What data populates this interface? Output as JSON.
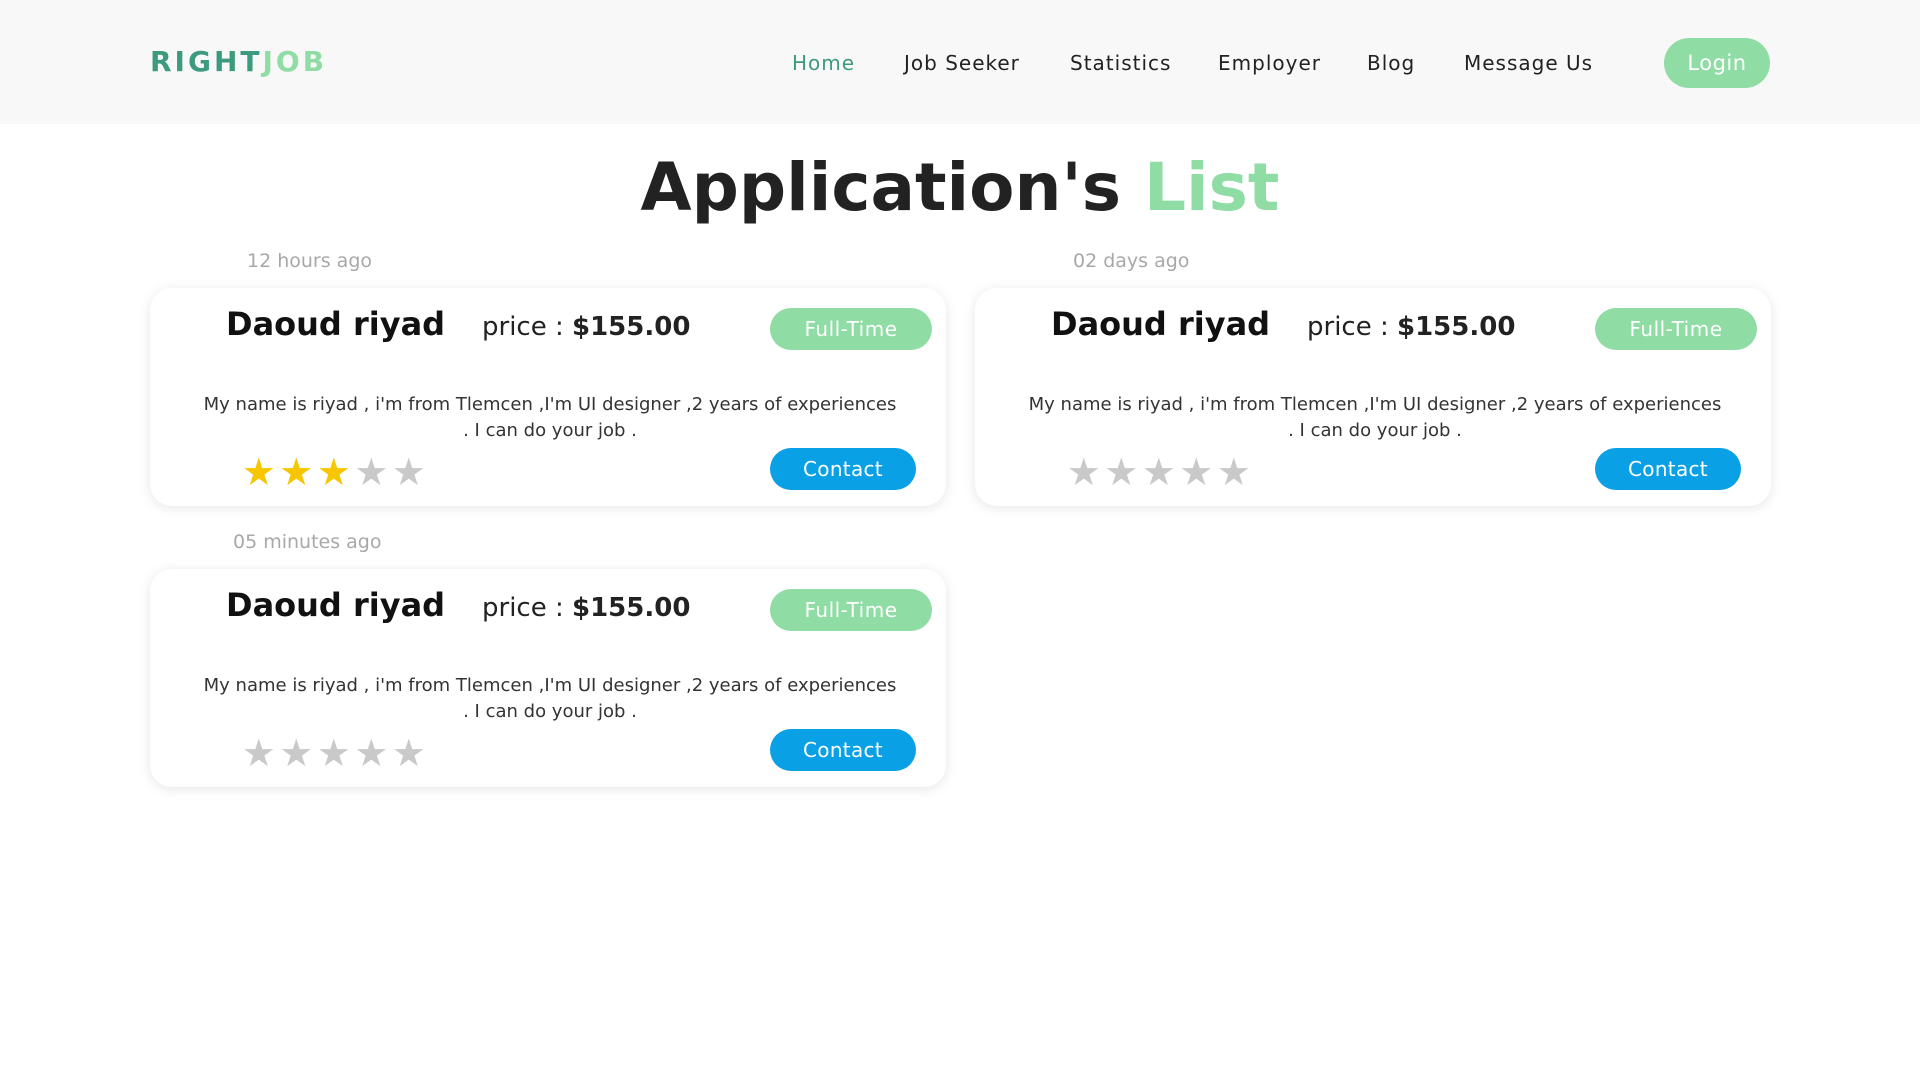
{
  "brand": {
    "logo_part1": "RIGHT",
    "logo_part2": "JOB"
  },
  "nav": {
    "items": [
      {
        "label": "Home"
      },
      {
        "label": "Job Seeker"
      },
      {
        "label": "Statistics"
      },
      {
        "label": "Employer"
      },
      {
        "label": "Blog"
      },
      {
        "label": "Message Us"
      }
    ],
    "active": "Home",
    "login_label": "Login"
  },
  "page": {
    "title_part1": "Application's",
    "title_part2": "List"
  },
  "applications": [
    {
      "time": "12 hours ago",
      "name": "Daoud riyad",
      "price_label": "price :",
      "price_value": "$155.00",
      "type": "Full-Time",
      "description": "My name is riyad , i'm from Tlemcen ,I'm UI designer ,2 years of experiences . I can do your job .",
      "rating": 3,
      "rating_max": 5,
      "contact_label": "Contact"
    },
    {
      "time": "02 days ago",
      "name": "Daoud riyad",
      "price_label": "price :",
      "price_value": "$155.00",
      "type": "Full-Time",
      "description": "My name is riyad , i'm from Tlemcen ,I'm UI designer ,2 years of experiences . I can do your job .",
      "rating": 0,
      "rating_max": 5,
      "contact_label": "Contact"
    },
    {
      "time": "05 minutes ago",
      "name": "Daoud riyad",
      "price_label": "price :",
      "price_value": "$155.00",
      "type": "Full-Time",
      "description": "My name is riyad , i'm from Tlemcen ,I'm UI designer ,2 years of experiences . I can do your job .",
      "rating": 0,
      "rating_max": 5,
      "contact_label": "Contact"
    }
  ],
  "colors": {
    "brand_dark": "#3c9a7e",
    "accent_green": "#8fdca5",
    "contact_blue": "#0aa0e6",
    "star_on": "#f7c600",
    "star_off": "#c9c9c9"
  },
  "icons": {
    "star": "star-icon"
  }
}
